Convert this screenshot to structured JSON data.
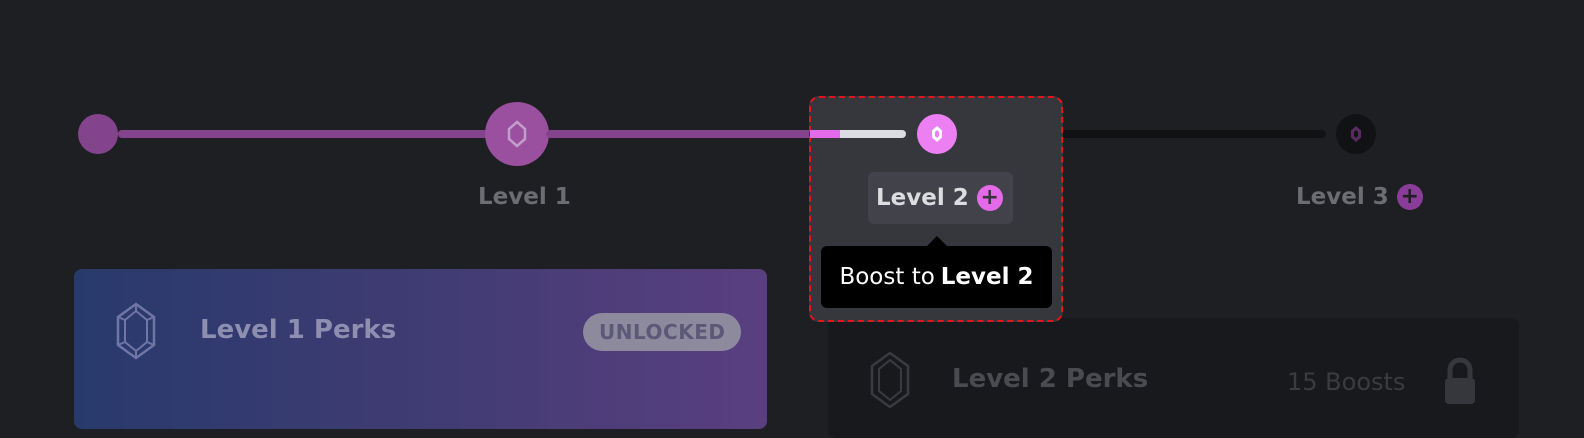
{
  "progress": {
    "current_level": 2,
    "level2_partial_fill": 0.3,
    "colors": {
      "accent": "#e46ae9",
      "unlocked_track": "#84448d",
      "locked_track": "#111214",
      "highlight_border": "#e0161b"
    },
    "levels": [
      {
        "label": "Level 1",
        "icon": "gem-icon",
        "state": "unlocked"
      },
      {
        "label": "Level 2",
        "icon": "gem-icon",
        "state": "current",
        "add_icon": "plus-icon"
      },
      {
        "label": "Level 3",
        "icon": "gem-icon",
        "state": "locked",
        "add_icon": "plus-icon"
      }
    ]
  },
  "tooltip": {
    "prefix": "Boost to",
    "level": "Level 2"
  },
  "cards": {
    "level1": {
      "title": "Level 1 Perks",
      "badge": "UNLOCKED",
      "icon": "gem-icon"
    },
    "level2": {
      "title": "Level 2 Perks",
      "boosts": "15 Boosts",
      "icon": "gem-icon",
      "lock_icon": "lock-icon"
    }
  }
}
